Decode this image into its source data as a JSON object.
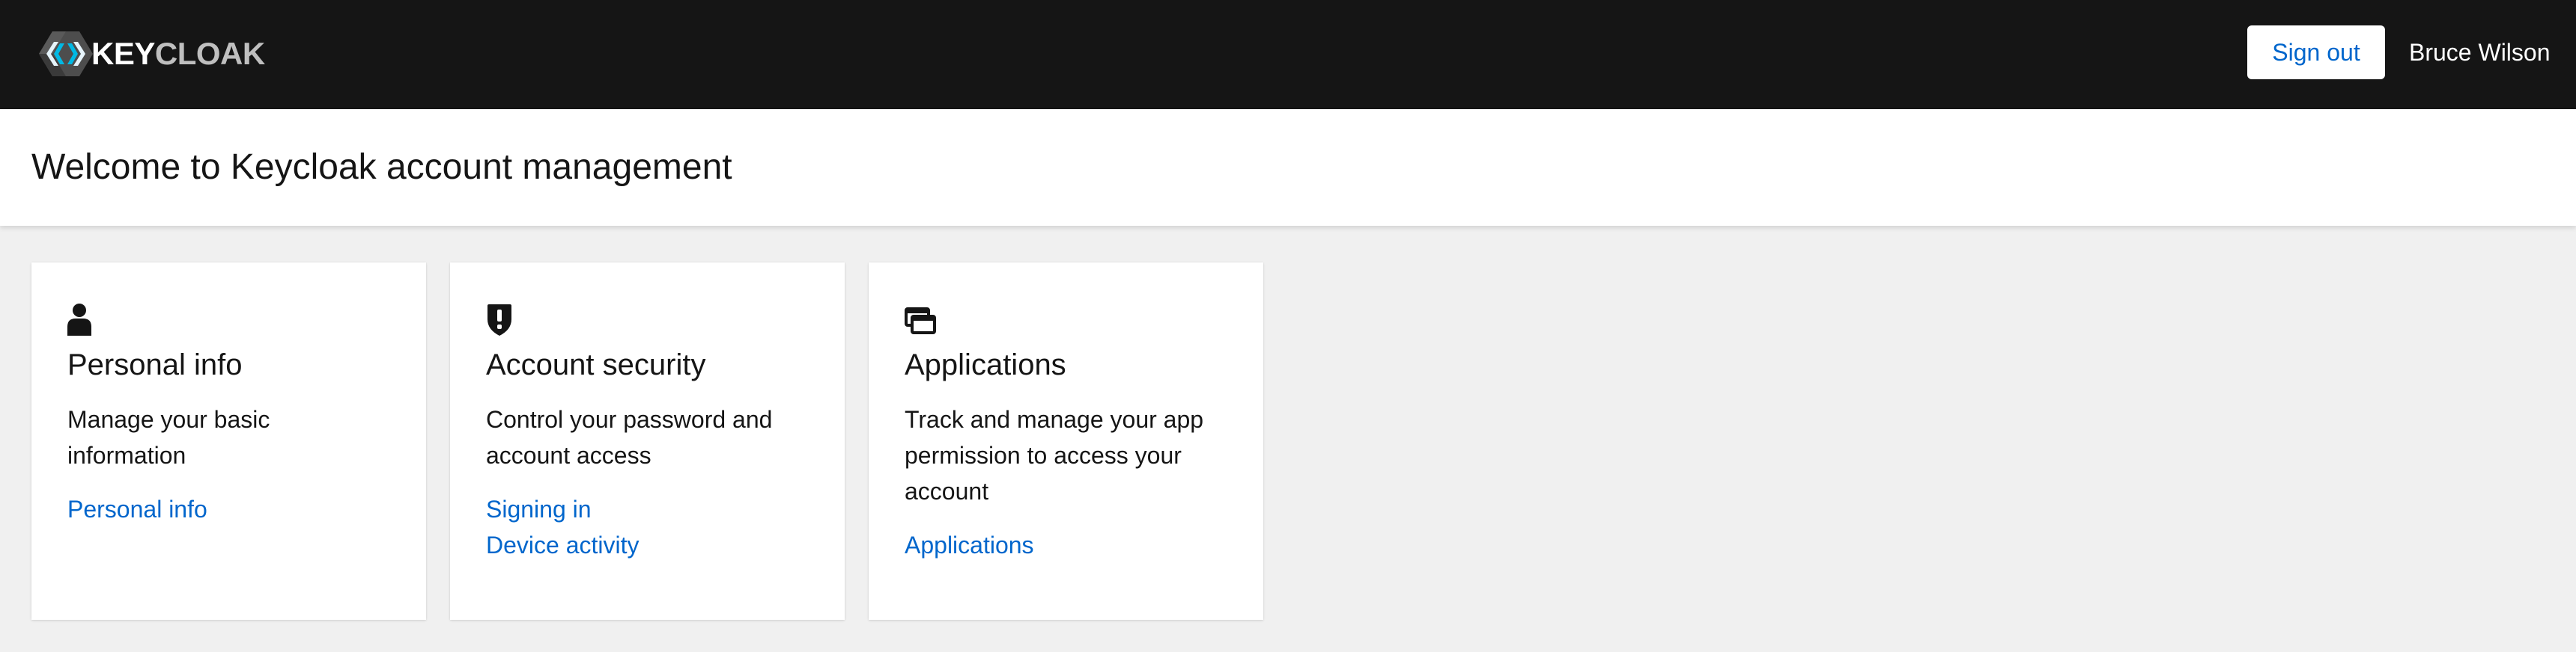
{
  "header": {
    "brand": {
      "part1": "KEY",
      "part2": "CLOAK"
    },
    "sign_out_label": "Sign out",
    "username": "Bruce Wilson",
    "background_color": "#151515"
  },
  "title": "Welcome to Keycloak account management",
  "accent_color": "#0066cc",
  "cards": [
    {
      "icon": "user-icon",
      "title": "Personal info",
      "description": "Manage your basic information",
      "links": [
        "Personal info"
      ]
    },
    {
      "icon": "shield-alert-icon",
      "title": "Account security",
      "description": "Control your password and account access",
      "links": [
        "Signing in",
        "Device activity"
      ]
    },
    {
      "icon": "applications-icon",
      "title": "Applications",
      "description": "Track and manage your app permission to access your account",
      "links": [
        "Applications"
      ]
    }
  ]
}
